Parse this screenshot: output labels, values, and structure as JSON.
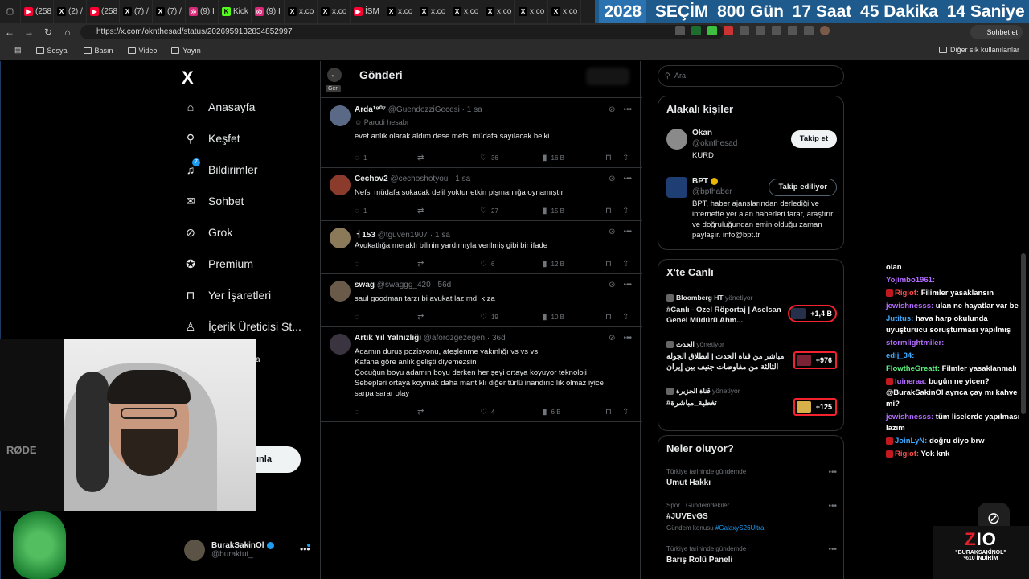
{
  "browser": {
    "tabs": [
      {
        "label": "(258",
        "fav": "yt"
      },
      {
        "label": "(2) /",
        "fav": "x"
      },
      {
        "label": "(258",
        "fav": "yt"
      },
      {
        "label": "(7) /",
        "fav": "x"
      },
      {
        "label": "(7) /",
        "fav": "x"
      },
      {
        "label": "(9) I",
        "fav": "ig"
      },
      {
        "label": "Kick",
        "fav": "kick"
      },
      {
        "label": "(9) I",
        "fav": "ig"
      },
      {
        "label": "x.co",
        "fav": "x"
      },
      {
        "label": "x.co",
        "fav": "x"
      },
      {
        "label": "İSM",
        "fav": "yt"
      },
      {
        "label": "x.co",
        "fav": "x"
      },
      {
        "label": "x.co",
        "fav": "x"
      },
      {
        "label": "x.co",
        "fav": "x"
      },
      {
        "label": "x.co",
        "fav": "x"
      },
      {
        "label": "x.co",
        "fav": "x"
      },
      {
        "label": "x.co",
        "fav": "x"
      }
    ],
    "url": "https://x.com/oknthesad/status/2026959132834852997",
    "chat_button": "Sohbet et",
    "bookmarks": [
      "Sosyal",
      "Basın",
      "Video",
      "Yayın"
    ],
    "other_bookmarks": "Diğer sık kullanılanlar"
  },
  "banner": {
    "year": "2028",
    "election": "SEÇİM",
    "days": "800 Gün",
    "hours": "17 Saat",
    "minutes": "45 Dakika",
    "seconds": "14 Saniye"
  },
  "nav": {
    "logo": "X",
    "items": [
      {
        "label": "Anasayfa"
      },
      {
        "label": "Keşfet"
      },
      {
        "label": "Bildirimler",
        "badge": "7"
      },
      {
        "label": "Sohbet"
      },
      {
        "label": "Grok"
      },
      {
        "label": "Premium"
      },
      {
        "label": "Yer İşaretleri"
      },
      {
        "label": "İçerik Üreticisi St..."
      }
    ],
    "post_button_fragment": "ınla",
    "ghost_letter": "a",
    "profile": {
      "name": "BurakSakinOl",
      "handle": "@buraktut_"
    }
  },
  "center": {
    "back_tooltip": "Geri",
    "title": "Gönderi",
    "replies": [
      {
        "name": "Arda¹⁹⁰⁷",
        "handle": "@GuendozziGecesi",
        "time": "· 1 sa",
        "parody": "Parodi hesabı",
        "text": "evet anlık olarak aldım dese mefsi müdafa sayılacak belki",
        "replies": "1",
        "retweets": "",
        "likes": "36",
        "views": "16 B"
      },
      {
        "name": "Cechov2",
        "handle": "@cechoshotyou",
        "time": "· 1 sa",
        "text": "Nefsi müdafa sokacak delil yoktur etkin pişmanlığa oynamıştır",
        "replies": "1",
        "retweets": "",
        "likes": "27",
        "views": "15 B"
      },
      {
        "name": "ㅓ153",
        "handle": "@tguven1907",
        "time": "· 1 sa",
        "text": "Avukatlığa meraklı bilinin yardımıyla verilmiş gibi bir ifade",
        "replies": "",
        "retweets": "",
        "likes": "6",
        "views": "12 B"
      },
      {
        "name": "swag",
        "handle": "@swaggg_420",
        "time": "· 56d",
        "text": "saul goodman tarzı bi avukat lazımdı kıza",
        "replies": "",
        "retweets": "",
        "likes": "19",
        "views": "10 B"
      },
      {
        "name": "Artık Yıl Yalnızlığı",
        "handle": "@aforozgezegen",
        "time": "· 36d",
        "text_lines": [
          "Adamın duruş pozisyonu, ateşlenme yakınlığı vs vs vs",
          "Kafana göre anlık gelişti diyemezsin",
          "Çocuğun boyu adamın boyu derken her şeyi ortaya koyuyor teknoloji",
          "Sebepleri ortaya koymak daha mantıklı diğer türlü inandırıcılık olmaz iyice",
          "sarpa sarar olay"
        ],
        "replies": "",
        "retweets": "",
        "likes": "4",
        "views": "6 B"
      }
    ]
  },
  "right": {
    "search_placeholder": "Ara",
    "related": {
      "title": "Alakalı kişiler",
      "people": [
        {
          "name": "Okan",
          "handle": "@oknthesad",
          "bio": "KURD",
          "button": "Takip et"
        },
        {
          "name": "BPT",
          "handle": "@bpthaber",
          "bio": "BPT, haber ajanslarından derlediği ve internette yer alan haberleri tarar, araştırır ve doğruluğundan emin olduğu zaman paylaşır. info@bpt.tr",
          "button": "Takip ediliyor"
        }
      ]
    },
    "live": {
      "title": "X'te Canlı",
      "items": [
        {
          "host": "Bloomberg HT",
          "meta": "yönetiyor",
          "title": "#Canlı - Özel Röportaj | Aselsan Genel Müdürü Ahm...",
          "count": "+1,4 B"
        },
        {
          "host": "الحدث",
          "meta": "yönetiyor",
          "title": "مباشر من قناة الحدث | انطلاق الجولة الثالثة من مفاوضات جنيف بين إيران",
          "count": "+976"
        },
        {
          "host": "قناة الجزيرة",
          "meta": "yönetiyor",
          "title": "#تغطية_مباشرة",
          "count": "+125"
        }
      ]
    },
    "trends": {
      "title": "Neler oluyor?",
      "items": [
        {
          "context": "Türkiye tarihinde gündemde",
          "title": "Umut Hakkı",
          "sub": ""
        },
        {
          "context": "Spor · Gündemdekiler",
          "title": "#JUVEvGS",
          "sub_prefix": "Gündem konusu",
          "sub_link": "#GalaxyS26Ultra"
        },
        {
          "context": "Türkiye tarihinde gündemde",
          "title": "Barış Rolü Paneli",
          "sub": ""
        }
      ]
    }
  },
  "stream_chat": [
    {
      "user": "",
      "msg": "olan",
      "ucolor": "#ffffff"
    },
    {
      "user": "Yojimbo1961:",
      "msg": "",
      "ucolor": "#b36bff"
    },
    {
      "user": "Rigiof:",
      "msg": "Filimler yasaklansın",
      "ucolor": "#ff4d4d",
      "badge": true
    },
    {
      "user": "jewishnesss:",
      "msg": "ulan ne hayatlar var be",
      "ucolor": "#b36bff"
    },
    {
      "user": "Jutitus:",
      "msg": "hava harp okulunda uyuşturucu soruşturması yapılmış",
      "ucolor": "#3fa9ff"
    },
    {
      "user": "stormlightmiler:",
      "msg": "",
      "ucolor": "#b36bff"
    },
    {
      "user": "edij_34:",
      "msg": "",
      "ucolor": "#3fa9ff"
    },
    {
      "user": "FlowtheGreatt:",
      "msg": "Filmler yasaklanmalı",
      "ucolor": "#5cf07c"
    },
    {
      "user": "luineraa:",
      "msg": "bugün ne yicen? @BurakSakinOl ayrıca çay mı kahve mi?",
      "ucolor": "#b36bff",
      "badge": true
    },
    {
      "user": "jewishnesss:",
      "msg": "tüm liselerde yapılması lazım",
      "ucolor": "#b36bff"
    },
    {
      "user": "JoinLyN:",
      "msg": "doğru diyo brw",
      "ucolor": "#3fa9ff",
      "badge": true
    },
    {
      "user": "Rigiof:",
      "msg": "Yok knk",
      "ucolor": "#ff4d4d",
      "badge": true
    }
  ],
  "overlay": {
    "brand": "ZIO",
    "promo": "\"BURAKSAKİNOL\"",
    "discount": "%10 İNDİRİM",
    "mic_label": "RØDE"
  },
  "colors": {
    "accent": "#1d9bf0",
    "banner_bg": "#1e5b8c",
    "live_border": "#f4212e"
  }
}
